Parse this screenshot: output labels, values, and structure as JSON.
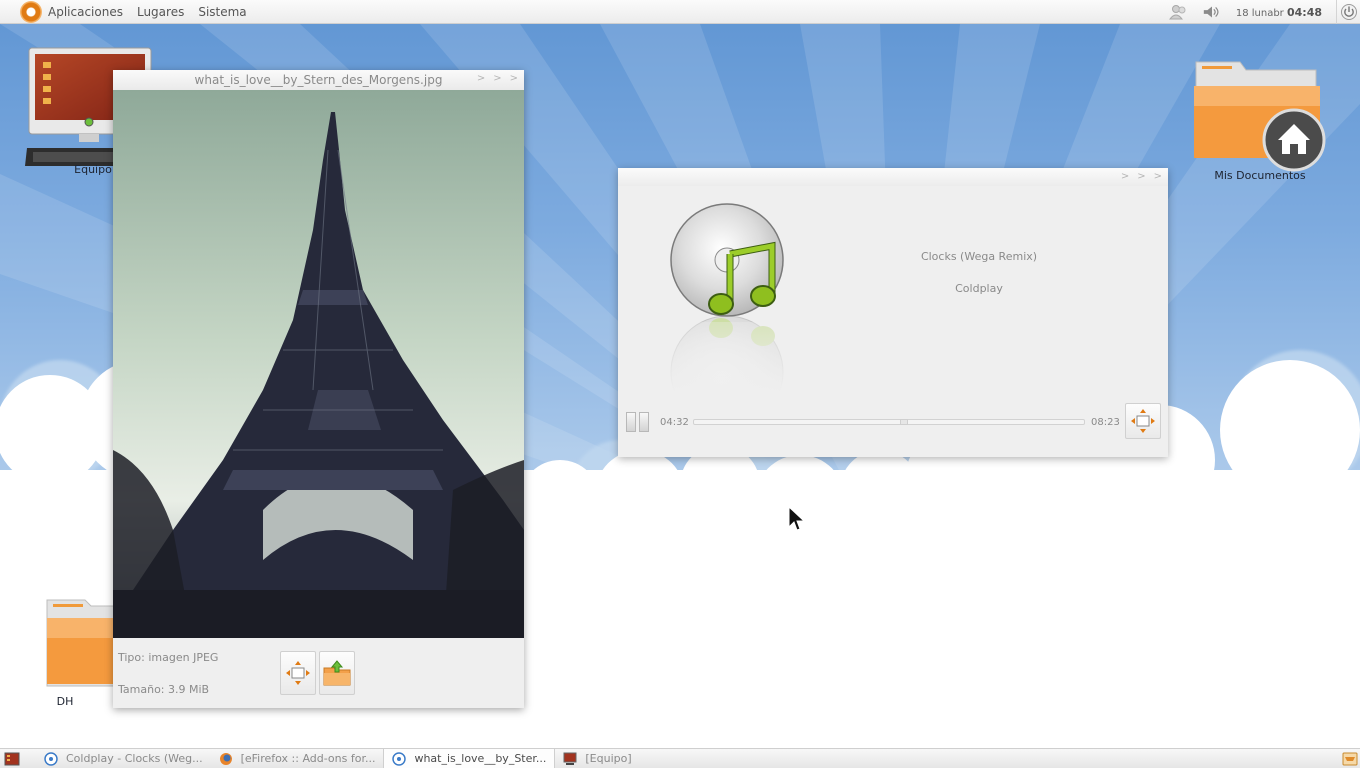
{
  "top_panel": {
    "menu": [
      "Aplicaciones",
      "Lugares",
      "Sistema"
    ],
    "clock_date": "18 lunabr",
    "clock_time": "04:48"
  },
  "desktop_icons": {
    "equipo": "Equipo",
    "mis_documentos": "Mis Documentos",
    "dh": "DH"
  },
  "image_viewer": {
    "title": "what_is_love__by_Stern_des_Morgens.jpg",
    "type_label": "Tipo: imagen JPEG",
    "size_label": "Tamaño: 3.9 MiB"
  },
  "music_player": {
    "track_title": "Clocks (Wega Remix)",
    "artist": "Coldplay",
    "elapsed": "04:32",
    "total": "08:23",
    "progress_fraction": 0.54
  },
  "taskbar": {
    "tasks": [
      "Coldplay - Clocks (Weg...",
      "[eFirefox :: Add-ons for...",
      "what_is_love__by_Ster...",
      "[Equipo]"
    ],
    "active_index": 2
  },
  "colors": {
    "accent_orange": "#e07b14",
    "folder_orange": "#f39a3c",
    "music_green": "#8fbf1f"
  }
}
